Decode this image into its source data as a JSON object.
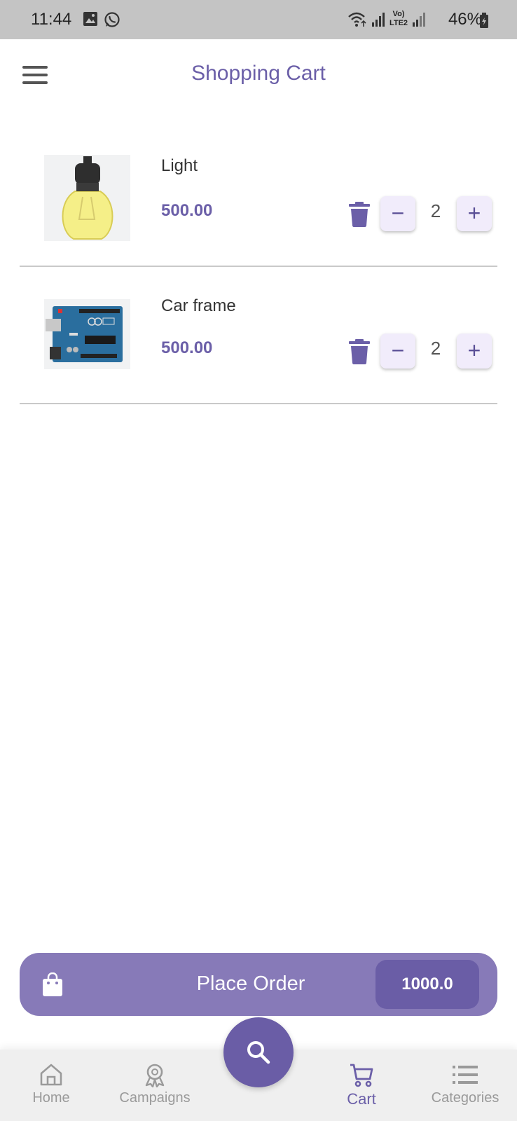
{
  "status_bar": {
    "time": "11:44",
    "battery": "46%",
    "network_label": "Vo) LTE2",
    "icons": [
      "gallery-icon",
      "whatsapp-icon",
      "wifi-icon",
      "signal-icon",
      "battery-icon"
    ]
  },
  "header": {
    "title": "Shopping Cart",
    "menu_icon": "hamburger-menu-icon"
  },
  "cart": {
    "items": [
      {
        "name": "Light",
        "price": "500.00",
        "quantity": "2",
        "image": "light-bulb-image"
      },
      {
        "name": "Car frame",
        "price": "500.00",
        "quantity": "2",
        "image": "arduino-board-image"
      }
    ]
  },
  "order": {
    "label": "Place Order",
    "total": "1000.0",
    "icon": "shopping-bag-icon"
  },
  "nav": {
    "items": [
      {
        "label": "Home",
        "icon": "home-icon",
        "active": false
      },
      {
        "label": "Campaigns",
        "icon": "award-icon",
        "active": false
      },
      {
        "label": "Cart",
        "icon": "cart-icon",
        "active": true
      },
      {
        "label": "Categories",
        "icon": "list-icon",
        "active": false
      }
    ],
    "fab_icon": "search-icon"
  },
  "colors": {
    "accent": "#6b5fa8",
    "order_bar": "#877ab8",
    "order_total_bg": "#6a5da6",
    "qty_button_bg": "#f1ecfb",
    "status_bar": "#c4c4c4",
    "nav_bg": "#efefef"
  }
}
